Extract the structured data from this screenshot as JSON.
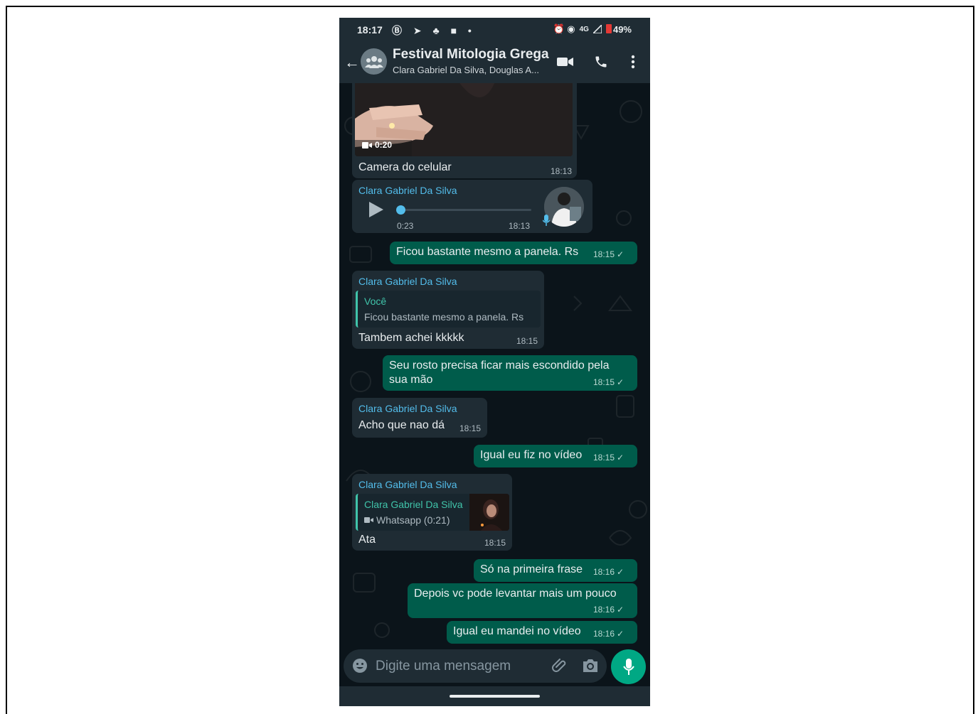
{
  "status": {
    "time": "18:17",
    "left_icons": "Ⓑ ➤ ♣ ■ •",
    "right_icons": "⏰ ◉",
    "network": "4G",
    "battery": "49%"
  },
  "header": {
    "back": "←",
    "title": "Festival Mitologia Grega",
    "subtitle": "Clara Gabriel Da Silva, Douglas A..."
  },
  "messages": {
    "m1": {
      "duration": "0:20",
      "caption": "Camera do celular",
      "time": "18:13"
    },
    "m2": {
      "sender": "Clara Gabriel Da Silva",
      "duration": "0:23",
      "time": "18:13"
    },
    "m3": {
      "text": "Ficou bastante mesmo a panela. Rs",
      "time": "18:15"
    },
    "m4": {
      "sender": "Clara Gabriel Da Silva",
      "quote_name": "Você",
      "quote_text": "Ficou bastante mesmo a panela. Rs",
      "text": "Tambem achei kkkkk",
      "time": "18:15"
    },
    "m5": {
      "line1": "Seu rosto precisa ficar mais escondido pela",
      "line2": "sua mão",
      "time": "18:15"
    },
    "m6": {
      "sender": "Clara Gabriel Da Silva",
      "text": "Acho que nao dá",
      "time": "18:15"
    },
    "m7": {
      "text": "Igual eu fiz no vídeo",
      "time": "18:15"
    },
    "m8": {
      "sender": "Clara Gabriel Da Silva",
      "quote_name": "Clara Gabriel Da Silva",
      "quote_text": "Whatsapp (0:21)",
      "text": "Ata",
      "time": "18:15"
    },
    "m9": {
      "text": "Só na primeira frase",
      "time": "18:16"
    },
    "m10": {
      "text": "Depois vc pode levantar mais um pouco",
      "time": "18:16"
    },
    "m11": {
      "text": "Igual eu mandei no vídeo",
      "time": "18:16"
    }
  },
  "composer": {
    "placeholder": "Digite uma mensagem"
  },
  "colors": {
    "outgoing": "#005c4b",
    "incoming": "#1f2c34",
    "accent": "#00a884",
    "sender": "#53bdeb"
  },
  "icons": [
    "arrow-back-icon",
    "group-avatar-icon",
    "video-call-icon",
    "phone-icon",
    "more-options-icon",
    "emoji-icon",
    "attach-icon",
    "camera-icon",
    "mic-icon",
    "play-icon",
    "video-badge-icon",
    "check-icon"
  ]
}
